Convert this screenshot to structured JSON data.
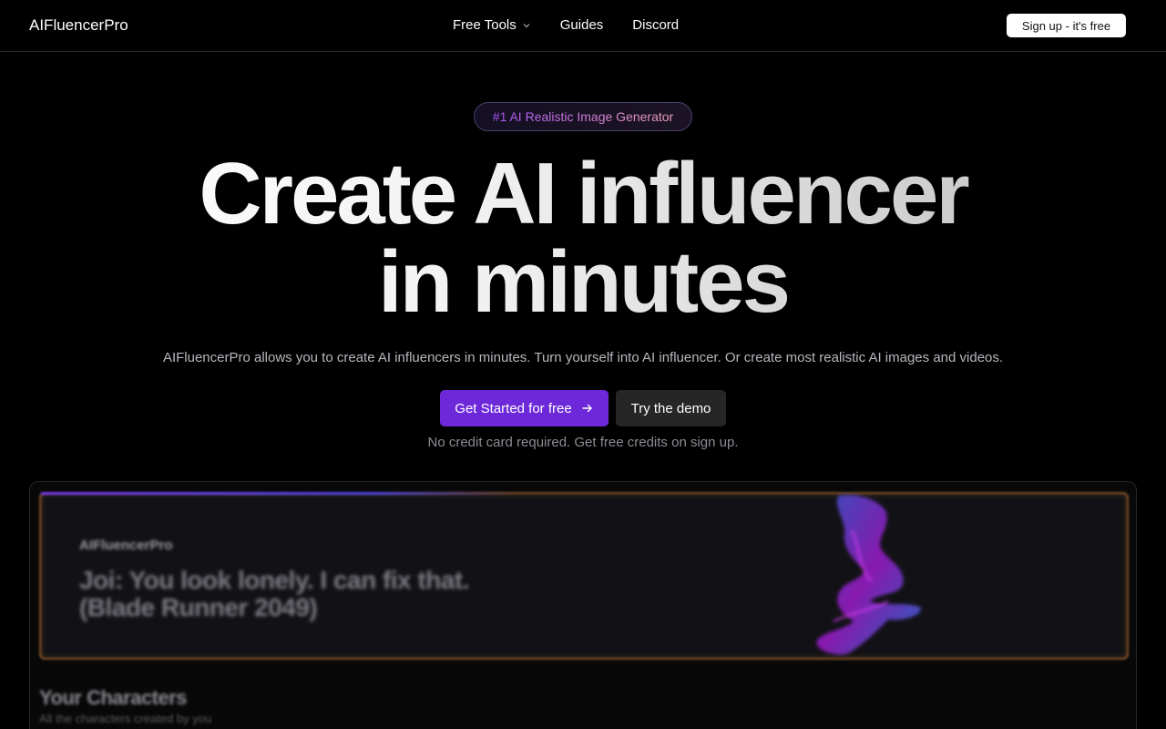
{
  "nav": {
    "logo": "AIFluencerPro",
    "links": [
      {
        "label": "Free Tools",
        "dropdown": true
      },
      {
        "label": "Guides"
      },
      {
        "label": "Discord"
      }
    ],
    "signup_label": "Sign up - it's free"
  },
  "hero": {
    "badge": "#1 AI Realistic Image Generator",
    "headline_line1": "Create AI influencer",
    "headline_line2": "in minutes",
    "subtitle": "AIFluencerPro allows you to create AI influencers in minutes. Turn yourself into AI influencer. Or create most realistic AI images and videos.",
    "primary_cta": "Get Started for free",
    "secondary_cta": "Try the demo",
    "note": "No credit card required. Get free credits on sign up."
  },
  "preview": {
    "brand": "AIFluencerPro",
    "title_line1": "Joi: You look lonely. I can fix that.",
    "title_line2": "(Blade Runner 2049)",
    "characters_title": "Your Characters",
    "characters_subtitle": "All the characters created by you"
  },
  "colors": {
    "accent": "#6d28d9",
    "background": "#000000",
    "banner_border": "#7a4e24"
  }
}
